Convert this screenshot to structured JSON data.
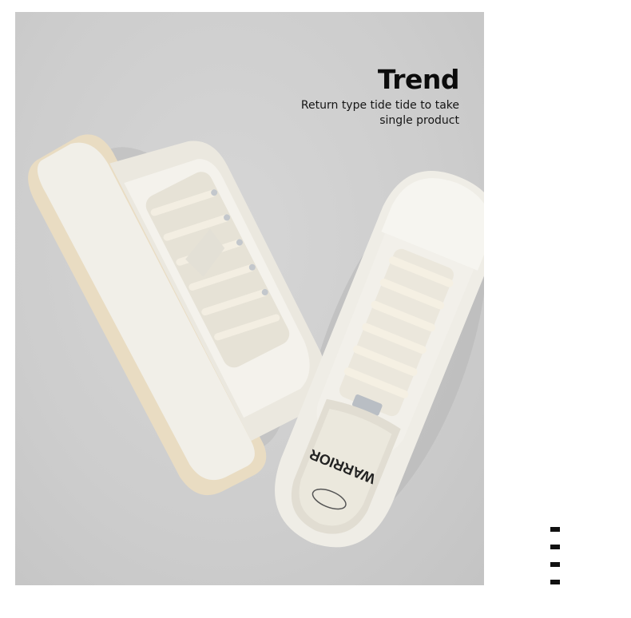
{
  "hero": {
    "title": "Trend",
    "subtitle_line1": "Return type tide tide to take",
    "subtitle_line2": "single product",
    "background_color": "#cfcfcf",
    "insole_brand_text": "WARRIOR"
  },
  "carousel": {
    "indicator_count": 4
  }
}
